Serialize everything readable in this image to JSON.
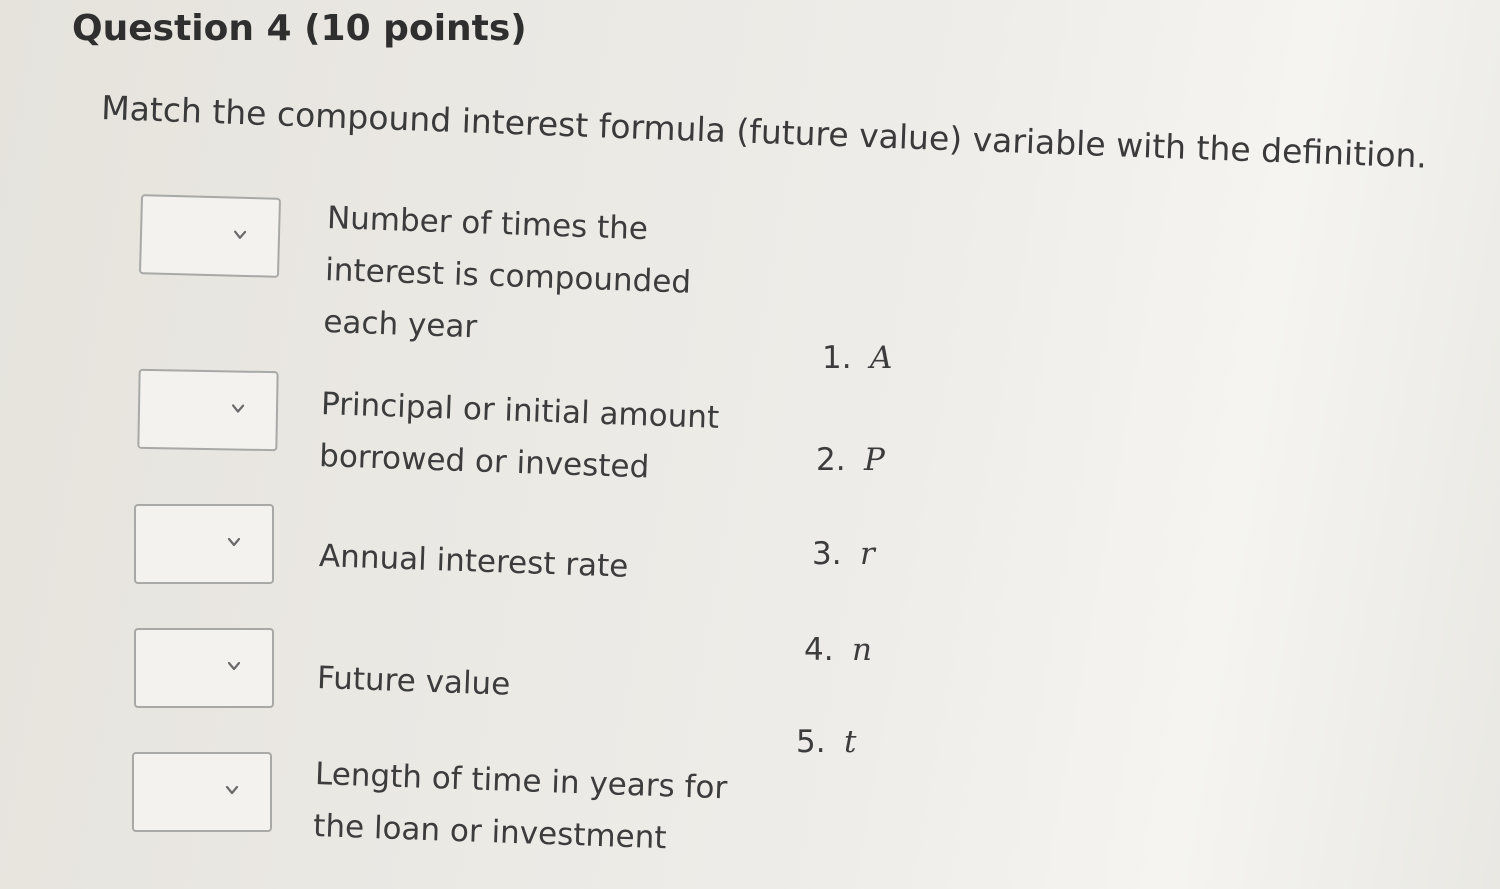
{
  "question": {
    "title": "Question 4 (10 points)",
    "instructions": "Match the compound interest formula (future value) variable with the definition."
  },
  "matches": [
    {
      "definition_lines": [
        "Number of times the",
        "interest is compounded",
        "each year"
      ],
      "selected": ""
    },
    {
      "definition_lines": [
        "Principal or initial amount",
        "borrowed or invested"
      ],
      "selected": ""
    },
    {
      "definition_lines": [
        "Annual interest rate"
      ],
      "selected": ""
    },
    {
      "definition_lines": [
        "Future value"
      ],
      "selected": ""
    },
    {
      "definition_lines": [
        "Length of time in years for",
        "the loan or investment"
      ],
      "selected": ""
    }
  ],
  "options": [
    {
      "number": "1.",
      "variable": "A"
    },
    {
      "number": "2.",
      "variable": "P"
    },
    {
      "number": "3.",
      "variable": "r"
    },
    {
      "number": "4.",
      "variable": "n"
    },
    {
      "number": "5.",
      "variable": "t"
    }
  ],
  "icons": {
    "dropdown": "chevron-down-icon"
  }
}
